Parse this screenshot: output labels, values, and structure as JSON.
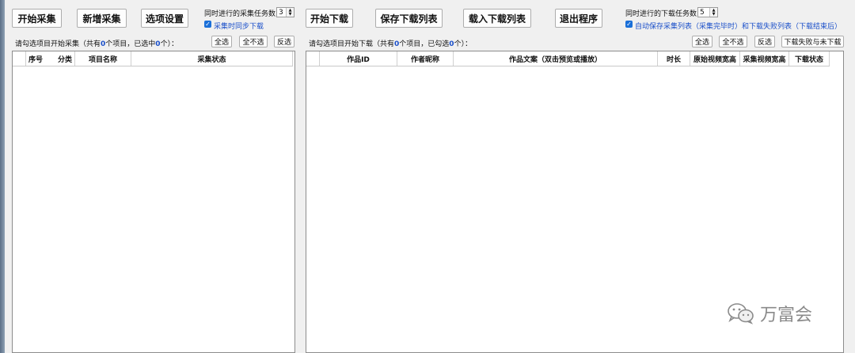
{
  "left_toolbar": {
    "start_collect": "开始采集",
    "add_collect": "新增采集",
    "options": "选项设置",
    "concurrent_collect_label": "同时进行的采集任务数",
    "concurrent_collect_value": "3",
    "sync_download_label": "采集时同步下载"
  },
  "right_toolbar": {
    "start_download": "开始下载",
    "save_list": "保存下载列表",
    "load_list": "载入下载列表",
    "exit": "退出程序",
    "concurrent_download_label": "同时进行的下载任务数",
    "concurrent_download_value": "5",
    "auto_save_label": "自动保存采集列表（采集完毕时）和下载失败列表（下载结束后）"
  },
  "left_selection": {
    "prefix": "请勾选项目开始采集（共有",
    "total": "0",
    "mid": "个项目，已选中",
    "selected": "0",
    "suffix": "个）：",
    "select_all": "全选",
    "select_none": "全不选",
    "invert": "反选"
  },
  "right_selection": {
    "prefix": "请勾选项目开始下载（共有",
    "total": "0",
    "mid": "个项目，已勾选",
    "selected": "0",
    "suffix": "个）：",
    "select_all": "全选",
    "select_none": "全不选",
    "invert": "反选",
    "download_failed": "下载失败与未下载"
  },
  "left_table": {
    "columns": [
      "序号",
      "分类",
      "项目名称",
      "采集状态"
    ]
  },
  "right_table": {
    "columns": [
      "作品ID",
      "作者昵称",
      "作品文案（双击预览或播放）",
      "时长",
      "原始视频宽高",
      "采集视频宽高",
      "下载状态"
    ]
  },
  "watermark": {
    "text": "万富会",
    "icon": "wechat-icon"
  },
  "colors": {
    "background": "#f0f0f0",
    "accent": "#1a4fc9",
    "checkbox": "#1a6fd8"
  }
}
